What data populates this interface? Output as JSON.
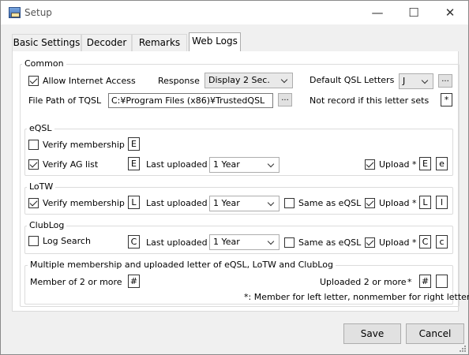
{
  "window": {
    "title": "Setup",
    "minimize": "—",
    "maximize": "☐",
    "close": "✕"
  },
  "tabs": [
    "Basic Settings",
    "Decoder",
    "Remarks",
    "Web Logs"
  ],
  "common": {
    "legend": "Common",
    "allow_internet": {
      "label": "Allow Internet Access",
      "checked": true
    },
    "response_label": "Response",
    "response_value": "Display 2 Sec.",
    "default_qsl_label": "Default QSL Letters",
    "default_qsl_value": "J",
    "browse": "...",
    "tqsl_label": "File Path of TQSL",
    "tqsl_value": "C:¥Program Files (x86)¥TrustedQSL",
    "not_record_label": "Not record if this letter sets",
    "not_record_value": "*"
  },
  "eqsl": {
    "legend": "eQSL",
    "verify_membership": {
      "label": "Verify membership",
      "checked": false,
      "letter": "E"
    },
    "verify_ag": {
      "label": "Verify AG list",
      "checked": true,
      "letter": "E"
    },
    "last_uploaded_label": "Last uploaded",
    "last_uploaded_value": "1 Year",
    "upload": {
      "label": "Upload",
      "checked": true,
      "star": "*",
      "left": "E",
      "right": "e"
    }
  },
  "lotw": {
    "legend": "LoTW",
    "verify_membership": {
      "label": "Verify membership",
      "checked": true,
      "letter": "L"
    },
    "last_uploaded_label": "Last uploaded",
    "last_uploaded_value": "1 Year",
    "same_as": {
      "label": "Same as eQSL",
      "checked": false
    },
    "upload": {
      "label": "Upload",
      "checked": true,
      "star": "*",
      "left": "L",
      "right": "l"
    }
  },
  "clublog": {
    "legend": "ClubLog",
    "log_search": {
      "label": "Log Search",
      "checked": false,
      "letter": "C"
    },
    "last_uploaded_label": "Last uploaded",
    "last_uploaded_value": "1 Year",
    "same_as": {
      "label": "Same as eQSL",
      "checked": false
    },
    "upload": {
      "label": "Upload",
      "checked": true,
      "star": "*",
      "left": "C",
      "right": "c"
    }
  },
  "multiple": {
    "legend": "Multiple membership and uploaded letter of eQSL, LoTW and ClubLog",
    "member_label": "Member of 2 or more",
    "member_value": "#",
    "uploaded_label": "Uploaded 2 or more",
    "uploaded_star": "*",
    "uploaded_left": "#",
    "uploaded_right": "",
    "note": "*: Member for left letter, nonmember for right letter"
  },
  "buttons": {
    "save": "Save",
    "cancel": "Cancel"
  }
}
